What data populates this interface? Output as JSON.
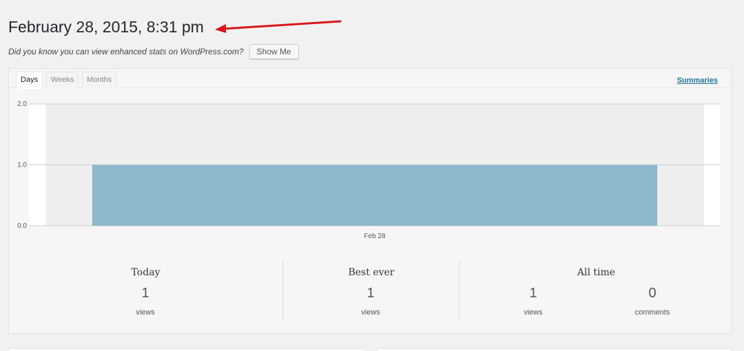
{
  "header": {
    "title": "February 28, 2015, 8:31 pm",
    "annotation_arrow_color": "#d9161b"
  },
  "promo": {
    "text": "Did you know you can view enhanced stats on WordPress.com?",
    "button_label": "Show Me"
  },
  "tabs": [
    {
      "label": "Days",
      "active": true
    },
    {
      "label": "Weeks",
      "active": false
    },
    {
      "label": "Months",
      "active": false
    }
  ],
  "summaries_link": "Summaries",
  "chart_data": {
    "type": "bar",
    "categories": [
      "Feb 28"
    ],
    "values": [
      1
    ],
    "ylim": [
      0,
      2
    ],
    "y_ticks": [
      "0.0",
      "1.0",
      "2.0"
    ],
    "grid": true,
    "bar_color": "#8db7cc",
    "plot_background": "#eeeeee"
  },
  "summary": {
    "today": {
      "heading": "Today",
      "value": "1",
      "label": "views"
    },
    "best_ever": {
      "heading": "Best ever",
      "value": "1",
      "label": "views"
    },
    "all_time": {
      "heading": "All time",
      "views_value": "1",
      "views_label": "views",
      "comments_value": "0",
      "comments_label": "comments"
    }
  }
}
